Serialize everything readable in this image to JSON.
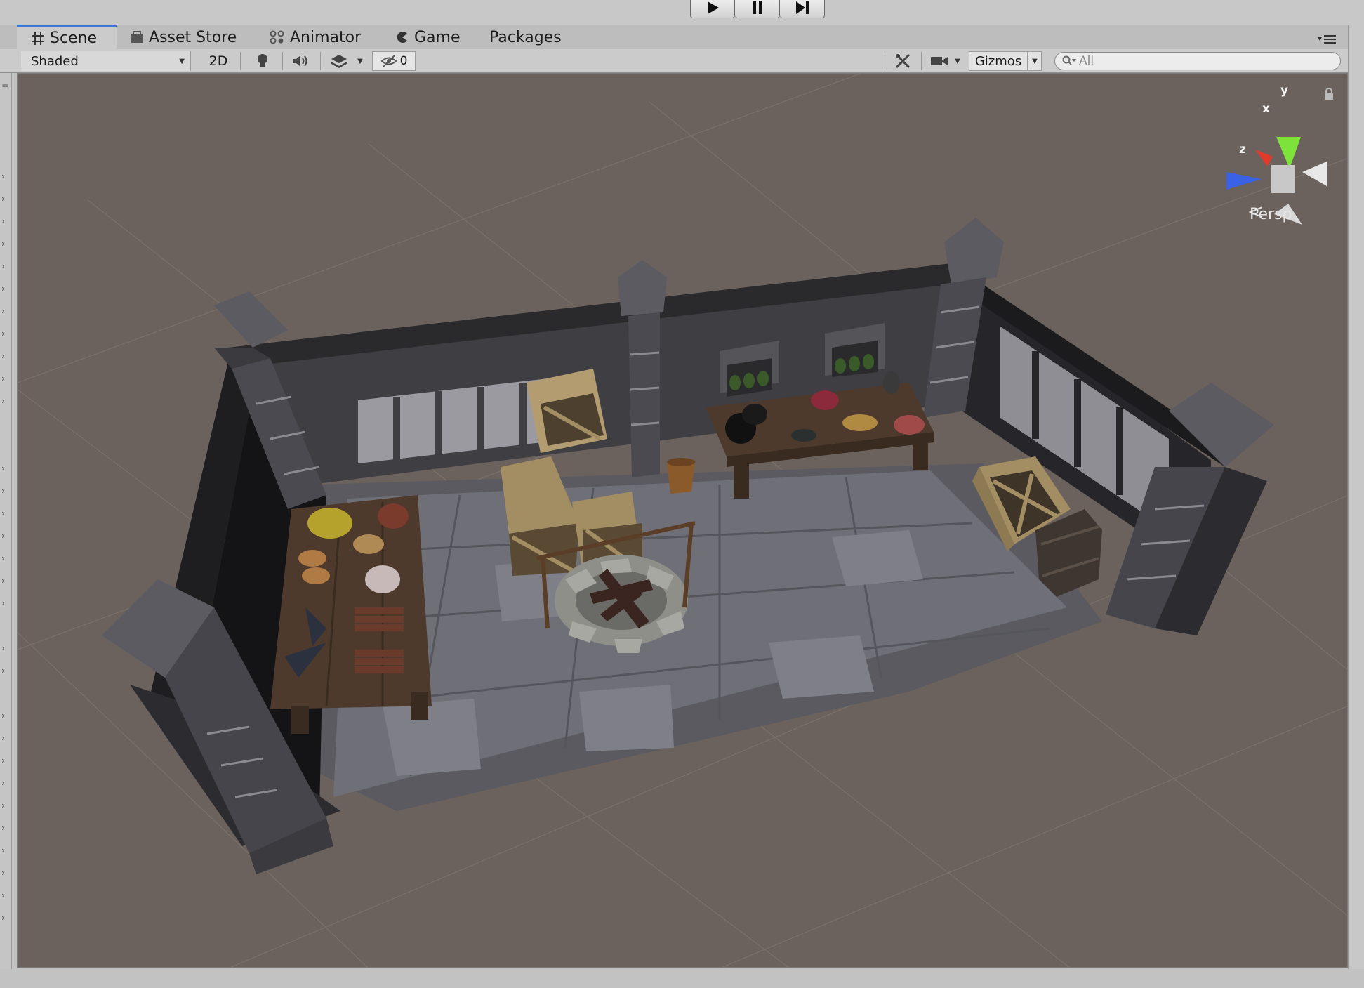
{
  "playbar": {
    "play": "play-icon",
    "pause": "pause-icon",
    "step": "step-icon"
  },
  "tabs": [
    {
      "label": "Scene",
      "icon": "grid-icon",
      "active": true
    },
    {
      "label": "Asset Store",
      "icon": "store-icon"
    },
    {
      "label": "Animator",
      "icon": "animator-icon"
    },
    {
      "label": "Game",
      "icon": "pacman-icon"
    },
    {
      "label": "Packages",
      "icon": ""
    }
  ],
  "toolbar": {
    "draw_mode": "Shaded",
    "toggle_2d": "2D",
    "hidden_count": "0",
    "gizmos": "Gizmos",
    "search_placeholder": "All"
  },
  "gizmo": {
    "y": "y",
    "x": "x",
    "z": "z",
    "projection": "Persp",
    "colors": {
      "y": "#7de33a",
      "x": "#e03a2a",
      "z": "#3a62e6"
    }
  },
  "scene": {
    "background": "#6b625d"
  }
}
